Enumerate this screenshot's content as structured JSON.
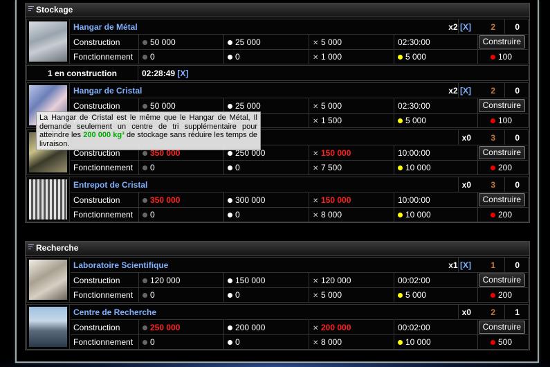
{
  "sections": [
    {
      "title": "Stockage",
      "buildings": [
        {
          "name": "Hangar de Métal",
          "count": "x2",
          "has_x": true,
          "x_label": "[X]",
          "level": "2",
          "queued": "0",
          "construction": {
            "metal": "50 000",
            "metal_red": false,
            "crystal": "25 000",
            "crystal_red": false,
            "deut": "5 000",
            "deut_red": false,
            "time": "02:30:00"
          },
          "operation": {
            "metal": "0",
            "crystal": "0",
            "deut": "1 000",
            "energy": "5 000",
            "bio": "100"
          }
        },
        {
          "name": "Hangar de Cristal",
          "count": "x2",
          "has_x": true,
          "x_label": "[X]",
          "level": "2",
          "queued": "0",
          "construction": {
            "metal": "50 000",
            "metal_red": false,
            "crystal": "25 000",
            "crystal_red": false,
            "deut": "5 000",
            "deut_red": false,
            "time": "02:30:00"
          },
          "operation": {
            "metal": "",
            "crystal": "",
            "deut": "1 500",
            "energy": "5 000",
            "bio": "100"
          }
        },
        {
          "name": "",
          "count": "x0",
          "has_x": false,
          "x_label": "",
          "level": "3",
          "queued": "0",
          "construction": {
            "metal": "350 000",
            "metal_red": true,
            "crystal": "250 000",
            "crystal_red": false,
            "deut": "150 000",
            "deut_red": true,
            "time": "10:00:00"
          },
          "operation": {
            "metal": "0",
            "crystal": "0",
            "deut": "7 500",
            "energy": "10 000",
            "bio": "200"
          }
        },
        {
          "name": "Entrepot de Cristal",
          "count": "x0",
          "has_x": false,
          "x_label": "",
          "level": "3",
          "queued": "0",
          "construction": {
            "metal": "350 000",
            "metal_red": true,
            "crystal": "300 000",
            "crystal_red": false,
            "deut": "150 000",
            "deut_red": true,
            "time": "10:00:00"
          },
          "operation": {
            "metal": "0",
            "crystal": "0",
            "deut": "8 000",
            "energy": "10 000",
            "bio": "200"
          }
        }
      ]
    },
    {
      "title": "Recherche",
      "buildings": [
        {
          "name": "Laboratoire Scientifique",
          "count": "x1",
          "has_x": true,
          "x_label": "[X]",
          "level": "1",
          "queued": "0",
          "construction": {
            "metal": "120 000",
            "metal_red": false,
            "crystal": "150 000",
            "crystal_red": false,
            "deut": "120 000",
            "deut_red": false,
            "time": "00:02:00"
          },
          "operation": {
            "metal": "0",
            "crystal": "0",
            "deut": "5 000",
            "energy": "5 000",
            "bio": "200"
          }
        },
        {
          "name": "Centre de Recherche",
          "count": "x0",
          "has_x": false,
          "x_label": "",
          "level": "2",
          "queued": "1",
          "construction": {
            "metal": "250 000",
            "metal_red": true,
            "crystal": "200 000",
            "crystal_red": false,
            "deut": "200 000",
            "deut_red": true,
            "time": "00:02:00"
          },
          "operation": {
            "metal": "0",
            "crystal": "0",
            "deut": "8 000",
            "energy": "10 000",
            "bio": "500"
          }
        }
      ]
    }
  ],
  "labels": {
    "construction": "Construction",
    "operation": "Fonctionnement",
    "build_button": "Construire"
  },
  "queue": {
    "text": "1 en construction",
    "time": "02:28:49",
    "x_label": "[X]"
  },
  "tooltip": {
    "before": "La Hangar de Cristal est le même que le Hangar de Métal, Il demande seulement un centre de tri supplémentaire pour atteindre les",
    "highlight": "200 000 kg³",
    "after": "de stockage sans réduire les temps de livraison."
  },
  "icons": {
    "metal": "grey-dot-icon",
    "crystal": "white-dot-icon",
    "deut": "cross-arrows-icon",
    "energy": "yellow-dot-icon",
    "bio": "red-dot-icon"
  }
}
